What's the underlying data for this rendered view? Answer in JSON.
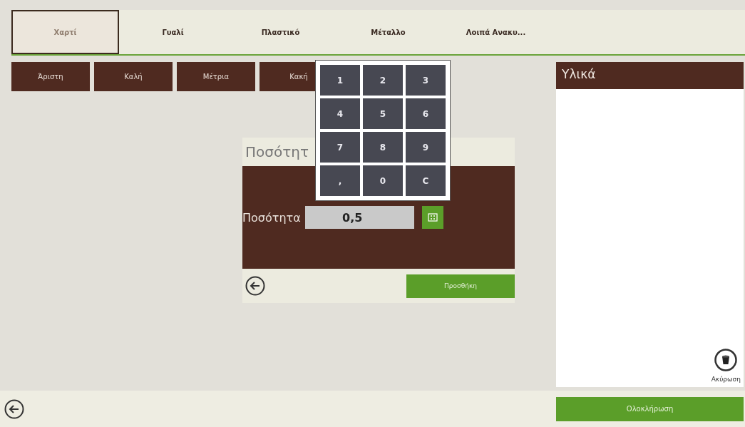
{
  "tabs": [
    {
      "label": "Χαρτί",
      "selected": true
    },
    {
      "label": "Γυαλί",
      "selected": false
    },
    {
      "label": "Πλαστικό",
      "selected": false
    },
    {
      "label": "Μέταλλο",
      "selected": false
    },
    {
      "label": "Λοιπά Ανακυ...",
      "selected": false
    }
  ],
  "grades": [
    "Άριστη",
    "Καλή",
    "Μέτρια",
    "Κακή"
  ],
  "materials_panel": {
    "title": "Υλικά",
    "cancel_label": "Ακύρωση"
  },
  "quantity_dialog": {
    "title": "Ποσότητ",
    "label": "Ποσότητα",
    "value": "0,5",
    "add_button": "Προσθήκη"
  },
  "keypad": {
    "keys": [
      "1",
      "2",
      "3",
      "4",
      "5",
      "6",
      "7",
      "8",
      "9",
      ",",
      "0",
      "C"
    ]
  },
  "complete_button": "Ολοκλήρωση"
}
